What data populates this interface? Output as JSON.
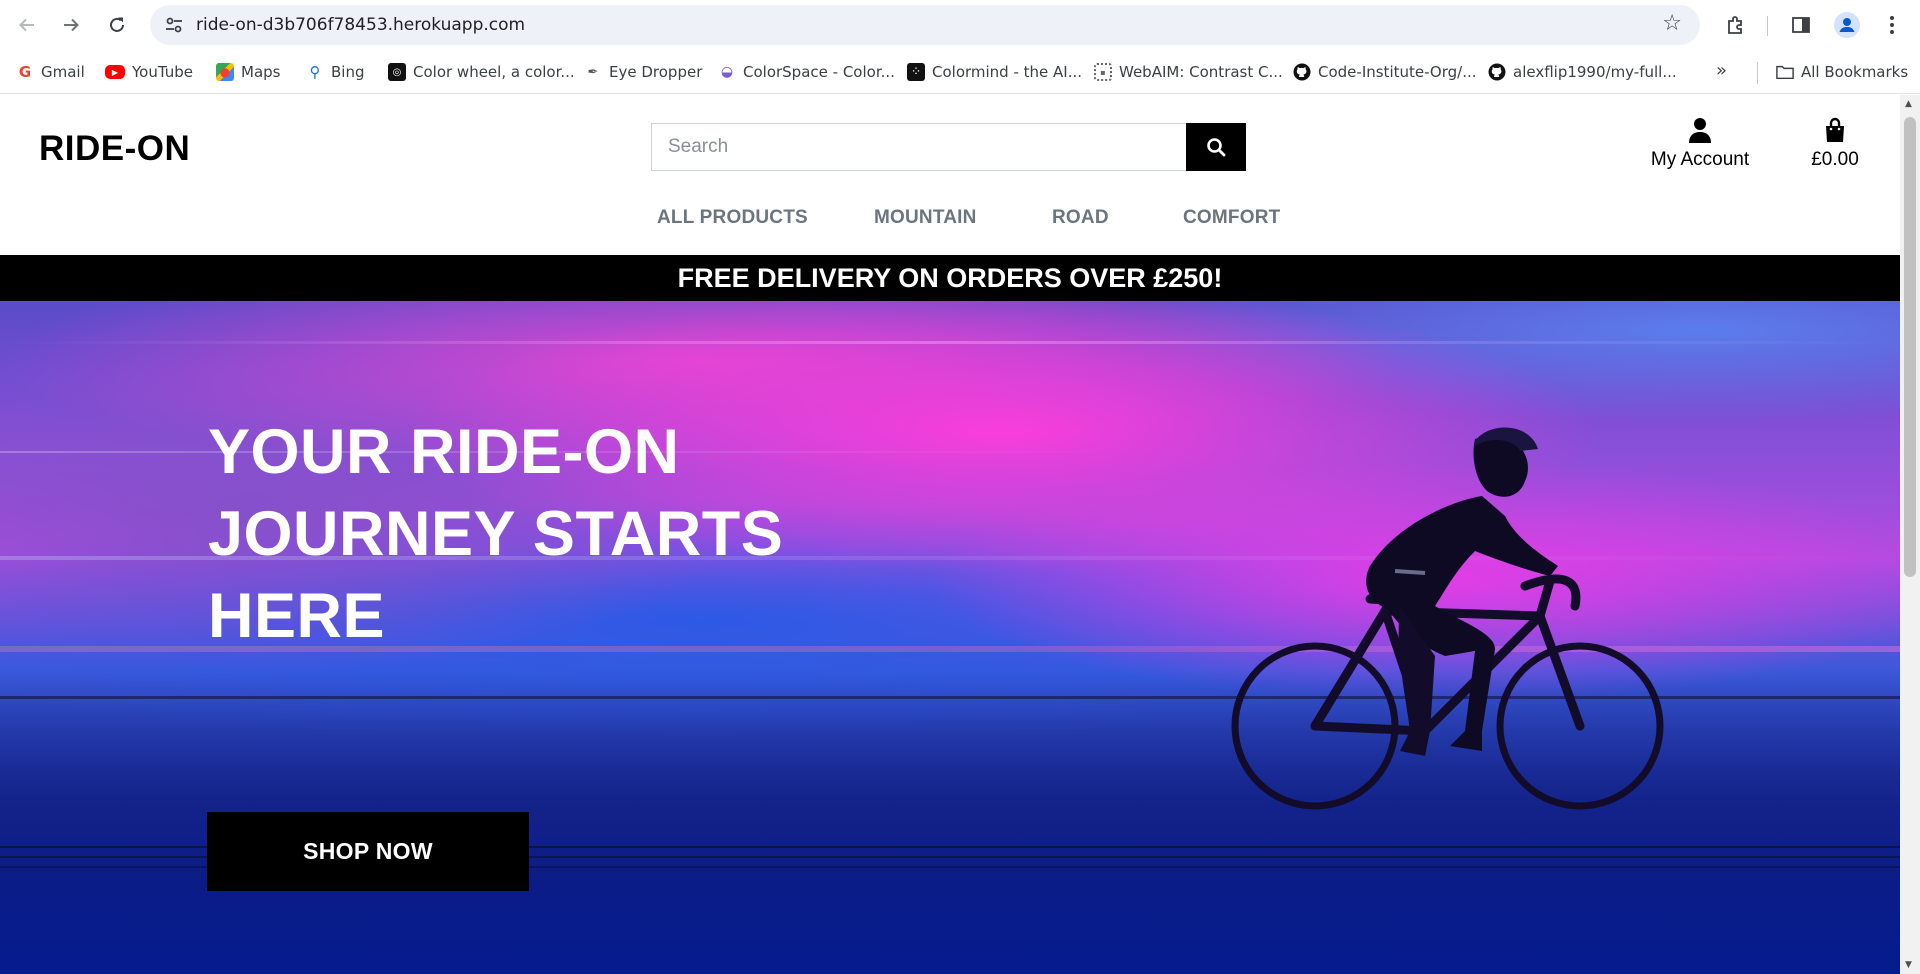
{
  "browser": {
    "url": "ride-on-d3b706f78453.herokuapp.com",
    "bookmarks": [
      {
        "label": "Gmail",
        "icon": "gmail-icon",
        "color": "#ea4335"
      },
      {
        "label": "YouTube",
        "icon": "youtube-icon",
        "color": "#ff0000"
      },
      {
        "label": "Maps",
        "icon": "maps-icon",
        "color": "#34a853"
      },
      {
        "label": "Bing",
        "icon": "bing-icon",
        "color": "#1a73e8"
      },
      {
        "label": "Color wheel, a color...",
        "icon": "color-wheel-icon",
        "color": "#000000"
      },
      {
        "label": "Eye Dropper",
        "icon": "eye-dropper-icon",
        "color": "#555555"
      },
      {
        "label": "ColorSpace - Color...",
        "icon": "colorspace-icon",
        "color": "#7b5cd6"
      },
      {
        "label": "Colormind - the AI...",
        "icon": "colormind-icon",
        "color": "#000000"
      },
      {
        "label": "WebAIM: Contrast C...",
        "icon": "webaim-icon",
        "color": "#666666"
      },
      {
        "label": "Code-Institute-Org/...",
        "icon": "github-icon",
        "color": "#000000"
      },
      {
        "label": "alexflip1990/my-full...",
        "icon": "github-icon",
        "color": "#000000"
      }
    ],
    "more_label": "»",
    "all_bookmarks_label": "All Bookmarks"
  },
  "header": {
    "logo": "RIDE-ON",
    "search_placeholder": "Search",
    "account_label": "My Account",
    "bag_total": "£0.00"
  },
  "nav": {
    "links": [
      "ALL PRODUCTS",
      "MOUNTAIN",
      "ROAD",
      "COMFORT"
    ]
  },
  "banner": {
    "text": "FREE DELIVERY ON ORDERS OVER £250!"
  },
  "hero": {
    "title_lines": [
      "YOUR RIDE-ON",
      "JOURNEY STARTS",
      "HERE"
    ],
    "cta_label": "SHOP NOW"
  },
  "colors": {
    "accent": "#000000",
    "nav_text": "#6c757d",
    "hero_pink": "#ff3cdc",
    "hero_blue": "#233aa8"
  }
}
